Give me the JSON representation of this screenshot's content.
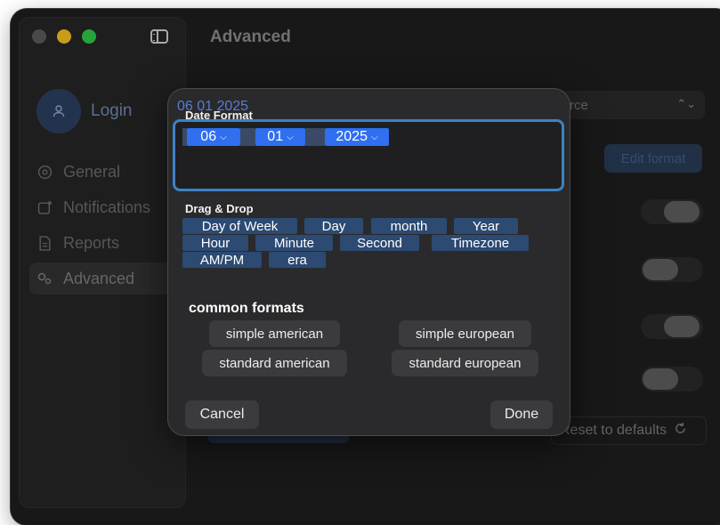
{
  "window": {
    "page_title": "Advanced"
  },
  "sidebar": {
    "login_label": "Login",
    "items": [
      {
        "label": "General",
        "icon": "gear-icon"
      },
      {
        "label": "Notifications",
        "icon": "notification-badge-icon"
      },
      {
        "label": "Reports",
        "icon": "document-icon"
      },
      {
        "label": "Advanced",
        "icon": "gears-icon",
        "active": true
      }
    ]
  },
  "background": {
    "select_value": "rce",
    "edit_format_label": "Edit format",
    "reset_label": "Reset to defaults"
  },
  "dialog": {
    "preview": "06 01 2025",
    "date_format_title": "Date Format",
    "tokens": [
      {
        "value": "06"
      },
      {
        "value": "01"
      },
      {
        "value": "2025"
      }
    ],
    "drag_drop_title": "Drag & Drop",
    "chips": [
      "Day of Week",
      "Day",
      "month",
      "Year",
      "Hour",
      "Minute",
      "Second",
      "Timezone",
      "AM/PM",
      "era"
    ],
    "common_formats_title": "common formats",
    "formats": [
      "simple american",
      "simple european",
      "standard american",
      "standard european"
    ],
    "cancel_label": "Cancel",
    "done_label": "Done"
  },
  "colors": {
    "accent": "#2f6ff0",
    "focus_ring": "#3b82c4",
    "chip": "#2c4a72",
    "traffic_min": "#f4bf1f",
    "traffic_max": "#2fc84a"
  }
}
